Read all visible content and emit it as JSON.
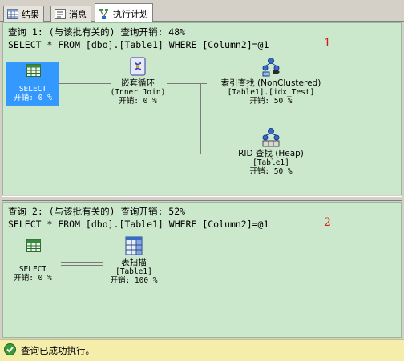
{
  "tabs": [
    {
      "label": "结果",
      "icon": "grid-results-icon"
    },
    {
      "label": "消息",
      "icon": "messages-icon"
    },
    {
      "label": "执行计划",
      "icon": "execution-plan-icon",
      "active": true
    }
  ],
  "queries": [
    {
      "title": "查询 1: (与该批有关的) 查询开销: 48%",
      "sql": "SELECT * FROM [dbo].[Table1] WHERE [Column2]=@1",
      "annotation": "1",
      "nodes": {
        "select": {
          "name": "SELECT",
          "cost": "开销: 0 %",
          "icon": "select-result-icon",
          "selected": true
        },
        "loop": {
          "name": "嵌套循环",
          "sub": "(Inner Join)",
          "cost": "开销: 0 %",
          "icon": "nested-loops-icon"
        },
        "seek": {
          "name": "索引查找 (NonClustered)",
          "sub": "[Table1].[idx_Test]",
          "cost": "开销: 50 %",
          "icon": "index-seek-icon"
        },
        "rid": {
          "name": "RID 查找 (Heap)",
          "sub": "[Table1]",
          "cost": "开销: 50 %",
          "icon": "rid-lookup-icon"
        }
      }
    },
    {
      "title": "查询 2: (与该批有关的) 查询开销: 52%",
      "sql": "SELECT * FROM [dbo].[Table1] WHERE [Column2]=@1",
      "annotation": "2",
      "nodes": {
        "select": {
          "name": "SELECT",
          "cost": "开销: 0 %",
          "icon": "select-result-icon"
        },
        "scan": {
          "name": "表扫描",
          "sub": "[Table1]",
          "cost": "开销: 100 %",
          "icon": "table-scan-icon"
        }
      }
    }
  ],
  "status": {
    "text": "查询已成功执行。",
    "icon": "success-check-icon"
  }
}
